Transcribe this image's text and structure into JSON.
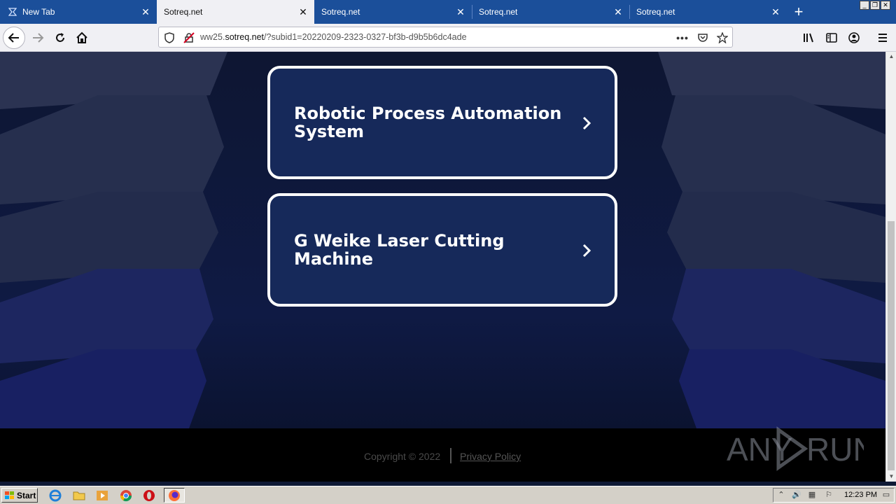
{
  "browser": {
    "tabs": [
      {
        "title": "New Tab",
        "active": false
      },
      {
        "title": "Sotreq.net",
        "active": true
      },
      {
        "title": "Sotreq.net",
        "active": false
      },
      {
        "title": "Sotreq.net",
        "active": false
      },
      {
        "title": "Sotreq.net",
        "active": false
      }
    ],
    "url": {
      "prefix": "ww25.",
      "host": "sotreq.net",
      "path": "/?subid1=20220209-2323-0327-bf3b-d9b5b6dc4ade"
    }
  },
  "page": {
    "cards": [
      {
        "title": "Robotic Process Automation System"
      },
      {
        "title": "G Weike Laser Cutting Machine"
      }
    ],
    "footer": {
      "copyright": "Copyright © 2022",
      "privacy_label": "Privacy Policy"
    }
  },
  "watermark": {
    "text": "ANY RUN"
  },
  "taskbar": {
    "start_label": "Start",
    "clock": "12:23 PM"
  },
  "colors": {
    "tabbar": "#1b4f9a",
    "page_bg": "#0e1733",
    "card_bg": "#16295a",
    "card_border": "#ffffff"
  }
}
